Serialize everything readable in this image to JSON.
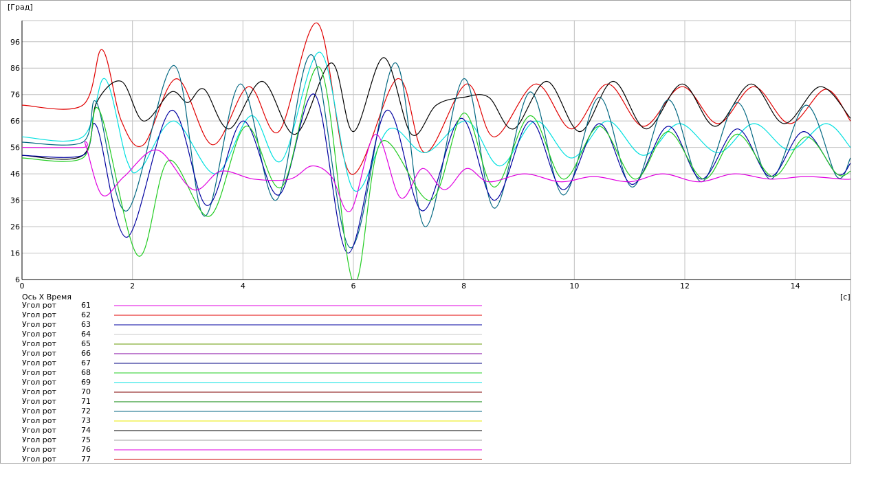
{
  "chart_data": {
    "type": "line",
    "y_unit_label": "[Град]",
    "x_unit_label": "[с]",
    "xlim": [
      0,
      15
    ],
    "ylim": [
      6,
      104
    ],
    "x_ticks": [
      "0",
      "2",
      "4",
      "6",
      "8",
      "10",
      "12",
      "14"
    ],
    "x_tick_values": [
      0,
      2,
      4,
      6,
      8,
      10,
      12,
      14
    ],
    "y_ticks": [
      "6",
      "16",
      "26",
      "36",
      "46",
      "56",
      "66",
      "76",
      "86",
      "96"
    ],
    "y_tick_values": [
      6,
      16,
      26,
      36,
      46,
      56,
      66,
      76,
      86,
      96
    ],
    "grid": true,
    "legend_header": "Ось X  Время",
    "legend": [
      {
        "name": "Угол рот",
        "id": "61",
        "color": "#e000e0"
      },
      {
        "name": "Угол рот",
        "id": "62",
        "color": "#e00000"
      },
      {
        "name": "Угол рот",
        "id": "63",
        "color": "#0000a0"
      },
      {
        "name": "Угол рот",
        "id": "64",
        "color": "#c8c8c8"
      },
      {
        "name": "Угол рот",
        "id": "65",
        "color": "#669900"
      },
      {
        "name": "Угол рот",
        "id": "66",
        "color": "#8000a0"
      },
      {
        "name": "Угол рот",
        "id": "67",
        "color": "#000080"
      },
      {
        "name": "Угол рот",
        "id": "68",
        "color": "#22cc22"
      },
      {
        "name": "Угол рот",
        "id": "69",
        "color": "#00e0e0"
      },
      {
        "name": "Угол рот",
        "id": "70",
        "color": "#800000"
      },
      {
        "name": "Угол рот",
        "id": "71",
        "color": "#008000"
      },
      {
        "name": "Угол рот",
        "id": "72",
        "color": "#006680"
      },
      {
        "name": "Угол рот",
        "id": "73",
        "color": "#e8e800"
      },
      {
        "name": "Угол рот",
        "id": "74",
        "color": "#000000"
      },
      {
        "name": "Угол рот",
        "id": "75",
        "color": "#a0a0a0"
      },
      {
        "name": "Угол рот",
        "id": "76",
        "color": "#e000e0"
      },
      {
        "name": "Угол рот",
        "id": "77",
        "color": "#cc0000"
      }
    ],
    "series": [
      {
        "color": "#e00000",
        "x": [
          0,
          1.1,
          1.45,
          1.8,
          2.2,
          2.8,
          3.45,
          4.1,
          4.65,
          5.35,
          5.95,
          6.8,
          7.3,
          8.05,
          8.55,
          9.3,
          9.95,
          10.6,
          11.25,
          11.95,
          12.6,
          13.25,
          13.9,
          14.55,
          15
        ],
        "y": [
          72,
          72,
          93,
          66,
          57,
          82,
          57,
          79,
          62,
          103,
          46,
          82,
          54,
          80,
          60,
          80,
          63,
          80,
          64,
          79,
          65,
          79,
          65,
          78,
          66
        ]
      },
      {
        "color": "#00e0e0",
        "x": [
          0,
          1.1,
          1.5,
          1.9,
          2.15,
          2.75,
          3.5,
          4.15,
          4.7,
          5.4,
          6.0,
          6.65,
          7.3,
          8.05,
          8.65,
          9.3,
          9.95,
          10.6,
          11.25,
          11.9,
          12.6,
          13.25,
          13.9,
          14.55,
          15
        ],
        "y": [
          60,
          60,
          82,
          51,
          48,
          66,
          46,
          68,
          51,
          92,
          40,
          63,
          54,
          66,
          49,
          66,
          52,
          66,
          53,
          65,
          54,
          65,
          55,
          65,
          56
        ]
      },
      {
        "color": "#000000",
        "x": [
          0,
          1.1,
          1.35,
          1.8,
          2.2,
          2.7,
          3.0,
          3.3,
          3.75,
          4.35,
          4.95,
          5.6,
          6.0,
          6.55,
          7.05,
          7.5,
          8.0,
          8.45,
          8.9,
          9.5,
          10.1,
          10.7,
          11.3,
          11.95,
          12.55,
          13.2,
          13.8,
          14.45,
          15
        ],
        "y": [
          53,
          53,
          73,
          81,
          66,
          77,
          73,
          78,
          63,
          81,
          61,
          88,
          62,
          90,
          61,
          72,
          75,
          75,
          63,
          81,
          62,
          81,
          63,
          80,
          64,
          80,
          65,
          79,
          67
        ]
      },
      {
        "color": "#006680",
        "x": [
          0,
          1.1,
          1.35,
          1.9,
          2.75,
          3.3,
          3.95,
          4.6,
          5.25,
          5.95,
          6.75,
          7.3,
          8.0,
          8.55,
          9.2,
          9.8,
          10.45,
          11.05,
          11.7,
          12.3,
          12.95,
          13.55,
          14.2,
          14.75,
          15
        ],
        "y": [
          58,
          58,
          73,
          32,
          87,
          30,
          80,
          36,
          91,
          18,
          88,
          26,
          82,
          33,
          77,
          38,
          75,
          41,
          74,
          43,
          73,
          44,
          72,
          45,
          52
        ]
      },
      {
        "color": "#0000a0",
        "x": [
          0,
          1.1,
          1.35,
          1.9,
          2.7,
          3.35,
          4.0,
          4.65,
          5.3,
          5.9,
          6.6,
          7.25,
          7.95,
          8.55,
          9.2,
          9.8,
          10.45,
          11.05,
          11.7,
          12.3,
          12.95,
          13.55,
          14.15,
          14.75,
          15
        ],
        "y": [
          53,
          53,
          64,
          22,
          70,
          34,
          66,
          38,
          76,
          16,
          70,
          32,
          67,
          36,
          66,
          40,
          65,
          42,
          64,
          44,
          63,
          45,
          62,
          46,
          50
        ]
      },
      {
        "color": "#22cc22",
        "x": [
          0,
          1.1,
          1.4,
          2.1,
          2.65,
          3.4,
          4.05,
          4.7,
          5.4,
          6.0,
          6.5,
          7.4,
          8.0,
          8.55,
          9.2,
          9.8,
          10.45,
          11.1,
          11.7,
          12.35,
          12.95,
          13.6,
          14.2,
          14.75,
          15
        ],
        "y": [
          52,
          52,
          70,
          15,
          51,
          30,
          64,
          41,
          86,
          5,
          58,
          36,
          69,
          41,
          68,
          44,
          64,
          44,
          62,
          44,
          61,
          45,
          60,
          46,
          47
        ]
      },
      {
        "color": "#e000e0",
        "x": [
          0,
          1.1,
          1.15,
          1.45,
          1.85,
          2.45,
          3.1,
          3.6,
          4.2,
          4.85,
          5.25,
          5.6,
          5.95,
          6.4,
          6.85,
          7.25,
          7.65,
          8.05,
          8.45,
          9.1,
          9.75,
          10.35,
          11.0,
          11.6,
          12.25,
          12.9,
          13.55,
          14.2,
          14.85,
          15
        ],
        "y": [
          56,
          56,
          57,
          38,
          45,
          55,
          40,
          47,
          44,
          44,
          49,
          45,
          32,
          61,
          37,
          48,
          40,
          48,
          43,
          46,
          43,
          45,
          43,
          46,
          43,
          46,
          44,
          45,
          44,
          44
        ]
      }
    ]
  }
}
